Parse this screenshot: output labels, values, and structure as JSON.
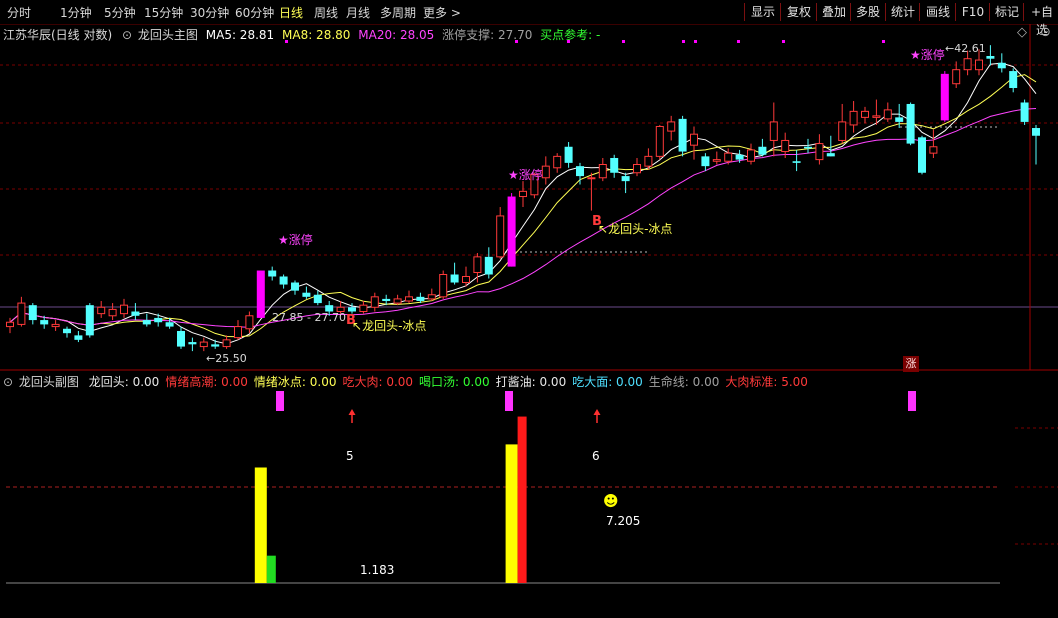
{
  "toolbar": {
    "periods": [
      "分时",
      "1分钟",
      "5分钟",
      "15分钟",
      "30分钟",
      "60分钟",
      "日线",
      "周线",
      "月线",
      "多周期",
      "更多"
    ],
    "active_period": "日线",
    "more_arrow": ">",
    "right_tools": [
      "显示",
      "复权",
      "叠加",
      "多股",
      "统计",
      "画线",
      "F10",
      "标记",
      "+自选"
    ]
  },
  "main_legend": {
    "stock": "江苏华辰(日线 对数)",
    "indicator_name": "龙回头主图",
    "ma5": "MA5: 28.81",
    "ma8": "MA8: 28.80",
    "ma20": "MA20: 28.05",
    "support": "涨停支撑: 27.70",
    "buy_ref": "买点参考: -"
  },
  "main_annotations": {
    "limit_up_1": "★涨停",
    "limit_up_2": "★涨停",
    "limit_up_3": "★涨停",
    "high_price": "42.61",
    "low_price": "25.50",
    "range_label": "27.85 - 27.70",
    "signal_1_letter": "B",
    "signal_1_text": "龙回头-冰点",
    "signal_2_letter": "B",
    "signal_2_text": "龙回头-冰点",
    "zhang_badge": "涨"
  },
  "sub_legend": {
    "indicator_name": "龙回头副图",
    "items": [
      {
        "label": "龙回头:",
        "value": "0.00",
        "color": "#e8e8e8"
      },
      {
        "label": "情绪高潮:",
        "value": "0.00",
        "color": "#ff3a3a"
      },
      {
        "label": "情绪冰点:",
        "value": "0.00",
        "color": "#ffff55"
      },
      {
        "label": "吃大肉:",
        "value": "0.00",
        "color": "#ff3a3a"
      },
      {
        "label": "喝口汤:",
        "value": "0.00",
        "color": "#33ff33"
      },
      {
        "label": "打酱油:",
        "value": "0.00",
        "color": "#e8e8e8"
      },
      {
        "label": "吃大面:",
        "value": "0.00",
        "color": "#4fe0ff"
      },
      {
        "label": "生命线:",
        "value": "0.00",
        "color": "#a0a0a0"
      },
      {
        "label": "大肉标准:",
        "value": "5.00",
        "color": "#ff3a3a"
      }
    ]
  },
  "sub_annotations": {
    "bar1_label": "5",
    "bar1_small": "1.183",
    "bar2_label": "6",
    "bar2_small": "7.205"
  },
  "colors": {
    "up": "#ff3a3a",
    "down": "#54ffff",
    "limit_up": "#ff00ff",
    "ma5": "#ffffff",
    "ma8": "#ffff55",
    "ma20": "#ff44ff",
    "grid": "#7a0000"
  },
  "chart_data": {
    "type": "candlestick",
    "ylabel": "",
    "candles": [
      {
        "o": 25.9,
        "c": 26.1,
        "h": 26.3,
        "l": 25.6
      },
      {
        "o": 26.0,
        "c": 27.0,
        "h": 27.3,
        "l": 25.9
      },
      {
        "o": 26.9,
        "c": 26.2,
        "h": 27.0,
        "l": 26.0
      },
      {
        "o": 26.2,
        "c": 26.0,
        "h": 26.4,
        "l": 25.8
      },
      {
        "o": 25.9,
        "c": 26.0,
        "h": 26.2,
        "l": 25.7
      },
      {
        "o": 25.8,
        "c": 25.6,
        "h": 25.9,
        "l": 25.4
      },
      {
        "o": 25.5,
        "c": 25.3,
        "h": 25.7,
        "l": 25.2
      },
      {
        "o": 26.9,
        "c": 25.5,
        "h": 27.0,
        "l": 25.4
      },
      {
        "o": 26.5,
        "c": 26.8,
        "h": 27.1,
        "l": 26.3
      },
      {
        "o": 26.4,
        "c": 26.7,
        "h": 27.0,
        "l": 26.2
      },
      {
        "o": 26.5,
        "c": 26.9,
        "h": 27.2,
        "l": 26.3
      },
      {
        "o": 26.6,
        "c": 26.4,
        "h": 27.0,
        "l": 26.2
      },
      {
        "o": 26.2,
        "c": 26.0,
        "h": 26.5,
        "l": 25.9
      },
      {
        "o": 26.3,
        "c": 26.1,
        "h": 26.5,
        "l": 25.9
      },
      {
        "o": 26.1,
        "c": 25.9,
        "h": 26.3,
        "l": 25.8
      },
      {
        "o": 25.7,
        "c": 25.0,
        "h": 25.9,
        "l": 24.9
      },
      {
        "o": 25.2,
        "c": 25.1,
        "h": 25.4,
        "l": 24.8
      },
      {
        "o": 25.0,
        "c": 25.2,
        "h": 25.4,
        "l": 24.8
      },
      {
        "o": 25.1,
        "c": 25.0,
        "h": 25.3,
        "l": 24.9
      },
      {
        "o": 25.0,
        "c": 25.3,
        "h": 25.5,
        "l": 24.9
      },
      {
        "o": 25.4,
        "c": 25.9,
        "h": 26.2,
        "l": 25.3
      },
      {
        "o": 25.8,
        "c": 26.4,
        "h": 26.6,
        "l": 25.6
      },
      {
        "o": 26.3,
        "c": 28.6,
        "h": 28.6,
        "l": 26.3
      },
      {
        "o": 28.6,
        "c": 28.3,
        "h": 28.8,
        "l": 28.1
      },
      {
        "o": 28.3,
        "c": 27.9,
        "h": 28.4,
        "l": 27.7
      },
      {
        "o": 28.0,
        "c": 27.6,
        "h": 28.1,
        "l": 27.4
      },
      {
        "o": 27.5,
        "c": 27.3,
        "h": 27.8,
        "l": 27.2
      },
      {
        "o": 27.4,
        "c": 27.0,
        "h": 27.6,
        "l": 26.9
      },
      {
        "o": 26.9,
        "c": 26.6,
        "h": 27.1,
        "l": 26.4
      },
      {
        "o": 26.6,
        "c": 26.8,
        "h": 27.1,
        "l": 26.5
      },
      {
        "o": 26.8,
        "c": 26.6,
        "h": 27.0,
        "l": 26.5
      },
      {
        "o": 26.6,
        "c": 26.9,
        "h": 27.1,
        "l": 26.5
      },
      {
        "o": 26.8,
        "c": 27.3,
        "h": 27.5,
        "l": 26.6
      },
      {
        "o": 27.2,
        "c": 27.1,
        "h": 27.4,
        "l": 26.9
      },
      {
        "o": 27.0,
        "c": 27.2,
        "h": 27.4,
        "l": 26.9
      },
      {
        "o": 27.1,
        "c": 27.3,
        "h": 27.6,
        "l": 27.0
      },
      {
        "o": 27.3,
        "c": 27.1,
        "h": 27.5,
        "l": 27.0
      },
      {
        "o": 27.2,
        "c": 27.4,
        "h": 27.7,
        "l": 27.1
      },
      {
        "o": 27.3,
        "c": 28.4,
        "h": 28.6,
        "l": 27.2
      },
      {
        "o": 28.4,
        "c": 28.0,
        "h": 29.0,
        "l": 27.9
      },
      {
        "o": 28.0,
        "c": 28.3,
        "h": 28.8,
        "l": 27.8
      },
      {
        "o": 28.5,
        "c": 29.3,
        "h": 29.5,
        "l": 28.0
      },
      {
        "o": 29.3,
        "c": 28.4,
        "h": 29.8,
        "l": 28.2
      },
      {
        "o": 29.3,
        "c": 31.5,
        "h": 32.0,
        "l": 29.2
      },
      {
        "o": 28.8,
        "c": 32.6,
        "h": 32.8,
        "l": 28.8
      },
      {
        "o": 32.6,
        "c": 32.9,
        "h": 33.5,
        "l": 32.0
      },
      {
        "o": 32.7,
        "c": 33.9,
        "h": 34.0,
        "l": 32.5
      },
      {
        "o": 33.7,
        "c": 34.4,
        "h": 35.0,
        "l": 33.3
      },
      {
        "o": 34.3,
        "c": 35.0,
        "h": 35.2,
        "l": 34.0
      },
      {
        "o": 35.6,
        "c": 34.6,
        "h": 35.9,
        "l": 34.3
      },
      {
        "o": 34.4,
        "c": 33.8,
        "h": 34.6,
        "l": 33.3
      },
      {
        "o": 33.7,
        "c": 33.7,
        "h": 34.0,
        "l": 31.8
      },
      {
        "o": 33.7,
        "c": 34.5,
        "h": 34.9,
        "l": 33.5
      },
      {
        "o": 34.9,
        "c": 34.0,
        "h": 35.1,
        "l": 33.7
      },
      {
        "o": 33.8,
        "c": 33.5,
        "h": 34.0,
        "l": 32.8
      },
      {
        "o": 34.0,
        "c": 34.5,
        "h": 34.9,
        "l": 33.8
      },
      {
        "o": 34.4,
        "c": 35.0,
        "h": 35.5,
        "l": 34.2
      },
      {
        "o": 35.0,
        "c": 36.9,
        "h": 37.0,
        "l": 34.8
      },
      {
        "o": 36.6,
        "c": 37.2,
        "h": 37.6,
        "l": 36.0
      },
      {
        "o": 37.4,
        "c": 35.3,
        "h": 37.6,
        "l": 35.0
      },
      {
        "o": 35.7,
        "c": 36.4,
        "h": 36.9,
        "l": 34.8
      },
      {
        "o": 35.0,
        "c": 34.4,
        "h": 35.2,
        "l": 34.1
      },
      {
        "o": 34.7,
        "c": 34.8,
        "h": 35.3,
        "l": 34.5
      },
      {
        "o": 34.7,
        "c": 35.2,
        "h": 35.5,
        "l": 34.5
      },
      {
        "o": 35.1,
        "c": 34.8,
        "h": 35.4,
        "l": 34.6
      },
      {
        "o": 34.7,
        "c": 35.4,
        "h": 35.8,
        "l": 34.5
      },
      {
        "o": 35.6,
        "c": 35.1,
        "h": 36.1,
        "l": 35.0
      },
      {
        "o": 36.0,
        "c": 37.2,
        "h": 38.5,
        "l": 35.0
      },
      {
        "o": 35.3,
        "c": 36.0,
        "h": 36.5,
        "l": 34.9
      },
      {
        "o": 34.7,
        "c": 34.6,
        "h": 35.4,
        "l": 34.1
      },
      {
        "o": 35.6,
        "c": 35.5,
        "h": 36.1,
        "l": 35.2
      },
      {
        "o": 34.8,
        "c": 35.8,
        "h": 36.4,
        "l": 34.5
      },
      {
        "o": 35.2,
        "c": 35.0,
        "h": 36.3,
        "l": 35.0
      },
      {
        "o": 36.0,
        "c": 37.2,
        "h": 38.4,
        "l": 35.8
      },
      {
        "o": 37.0,
        "c": 37.9,
        "h": 38.6,
        "l": 36.5
      },
      {
        "o": 37.5,
        "c": 37.9,
        "h": 38.2,
        "l": 37.1
      },
      {
        "o": 37.5,
        "c": 37.6,
        "h": 38.7,
        "l": 37.0
      },
      {
        "o": 37.4,
        "c": 38.0,
        "h": 38.5,
        "l": 37.2
      },
      {
        "o": 37.5,
        "c": 37.2,
        "h": 38.4,
        "l": 36.8
      },
      {
        "o": 38.4,
        "c": 35.8,
        "h": 38.5,
        "l": 35.7
      },
      {
        "o": 36.2,
        "c": 34.0,
        "h": 36.3,
        "l": 33.9
      },
      {
        "o": 35.2,
        "c": 35.6,
        "h": 36.7,
        "l": 34.9
      },
      {
        "o": 37.3,
        "c": 40.5,
        "h": 40.7,
        "l": 37.2
      },
      {
        "o": 39.8,
        "c": 40.8,
        "h": 41.4,
        "l": 39.5
      },
      {
        "o": 40.8,
        "c": 41.6,
        "h": 42.2,
        "l": 40.4
      },
      {
        "o": 40.8,
        "c": 41.5,
        "h": 42.3,
        "l": 40.4
      },
      {
        "o": 41.8,
        "c": 41.6,
        "h": 42.61,
        "l": 41.1
      },
      {
        "o": 41.3,
        "c": 40.9,
        "h": 42.0,
        "l": 40.6
      },
      {
        "o": 40.7,
        "c": 39.5,
        "h": 40.9,
        "l": 39.2
      },
      {
        "o": 38.5,
        "c": 37.2,
        "h": 38.7,
        "l": 37.0
      },
      {
        "o": 36.8,
        "c": 36.3,
        "h": 37.0,
        "l": 34.5
      }
    ],
    "limit_up_days": [
      22,
      44,
      82
    ],
    "sub_bars": [
      {
        "index": 22,
        "height": 5.0,
        "color": "yellow"
      },
      {
        "index": 23,
        "height": 1.183,
        "color": "green"
      },
      {
        "index": 44,
        "height": 6.0,
        "color": "yellow"
      },
      {
        "index": 45,
        "height": 7.205,
        "color": "red"
      }
    ]
  }
}
